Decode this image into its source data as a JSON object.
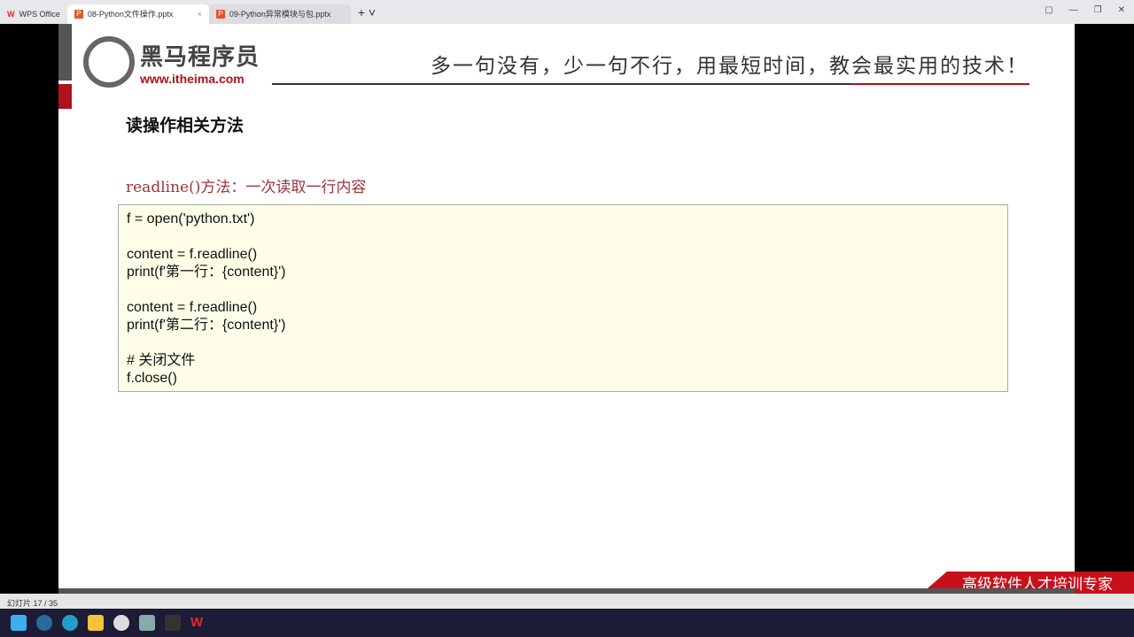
{
  "tabs": [
    {
      "label": "WPS Office"
    },
    {
      "label": "08-Python文件操作.pptx"
    },
    {
      "label": "09-Python异常模块与包.pptx"
    }
  ],
  "slide": {
    "brand": "黑马程序员",
    "url": "www.itheima.com",
    "slogan": "多一句没有，少一句不行，用最短时间，教会最实用的技术！",
    "title": "读操作相关方法",
    "subtitle": "readline()方法：一次读取一行内容",
    "code": "f = open('python.txt')\n\ncontent = f.readline()\nprint(f'第一行：{content}')\n\ncontent = f.readline()\nprint(f'第二行：{content}')\n\n# 关闭文件\nf.close()",
    "footer": "高级软件人才培训专家"
  },
  "status": {
    "slide_counter": "幻灯片 17 / 35"
  },
  "taskbar": [
    "start-icon",
    "search-icon",
    "edge-icon",
    "folder-icon",
    "clock-icon",
    "calculator-icon",
    "terminal-icon",
    "wps-icon"
  ]
}
